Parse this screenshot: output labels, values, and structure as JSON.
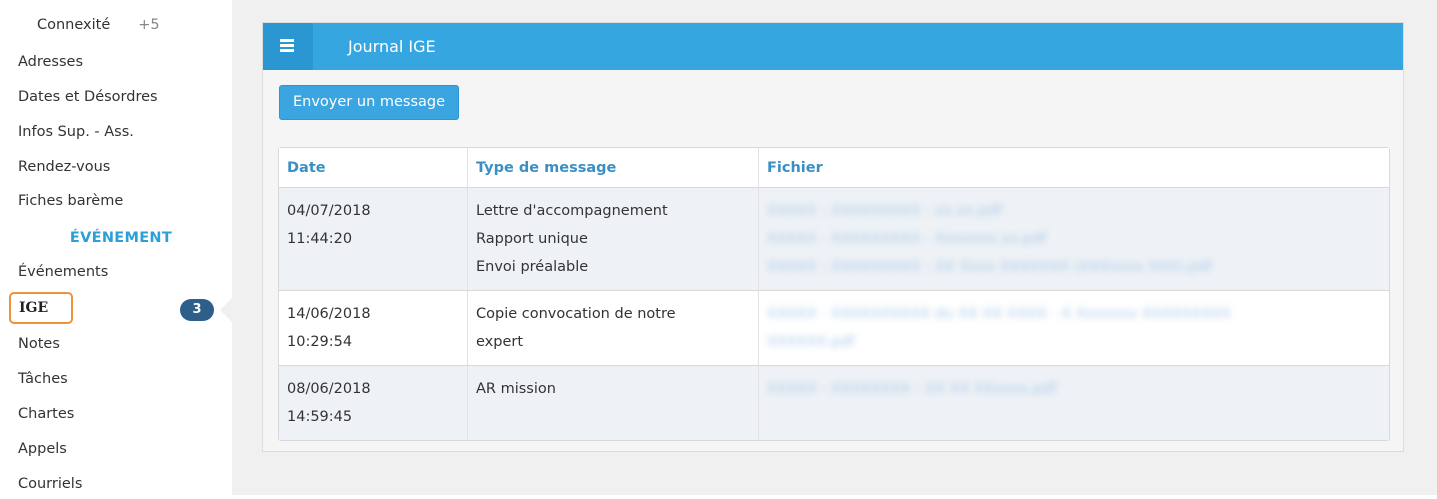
{
  "sidebar": {
    "items_top": [
      {
        "label": "Connexité",
        "extra": "+5"
      },
      {
        "label": "Adresses"
      },
      {
        "label": "Dates et Désordres"
      },
      {
        "label": "Infos Sup. - Ass."
      },
      {
        "label": "Rendez-vous"
      },
      {
        "label": "Fiches barème"
      }
    ],
    "section_title": "ÉVÉNEMENT",
    "items_bottom": [
      {
        "label": "Événements"
      },
      {
        "label": "IGE",
        "badge": "3",
        "active": true
      },
      {
        "label": "Notes"
      },
      {
        "label": "Tâches"
      },
      {
        "label": "Chartes"
      },
      {
        "label": "Appels"
      },
      {
        "label": "Courriels"
      }
    ],
    "active_border_color": "#f0923a",
    "badge_color": "#2e5f8a"
  },
  "panel": {
    "title": "Journal IGE",
    "menu_icon": "hamburger-icon",
    "header_color": "#36a6e0",
    "send_button_label": "Envoyer un message"
  },
  "table": {
    "headers": [
      "Date",
      "Type de message",
      "Fichier"
    ],
    "rows": [
      {
        "date": "04/07/2018",
        "time": "11:44:20",
        "types": [
          "Lettre d'accompagnement",
          "Rapport unique",
          "Envoi préalable"
        ],
        "files": [
          "XXXXX - XXXXXXXXX - xx.xx.pdf",
          "XXXXX - XXXXXXXXX - Xxxxxxx.xx.pdf",
          "XXXXX - XXXXXXXXX - XX Xxxx XXXXXXX (XXXxxxx XXX).pdf"
        ]
      },
      {
        "date": "14/06/2018",
        "time": "10:29:54",
        "types": [
          "Copie convocation de notre",
          "expert"
        ],
        "files": [
          "XXXXX - XXXXXXXXXX du XX XX XXXX - X Xxxxxxx XXXXXXXXX",
          "XXXXXX.pdf"
        ]
      },
      {
        "date": "08/06/2018",
        "time": "14:59:45",
        "types": [
          "AR mission"
        ],
        "files": [
          "XXXXX - XXXXXXXX - XX XX XXxxxx.pdf"
        ]
      }
    ]
  }
}
